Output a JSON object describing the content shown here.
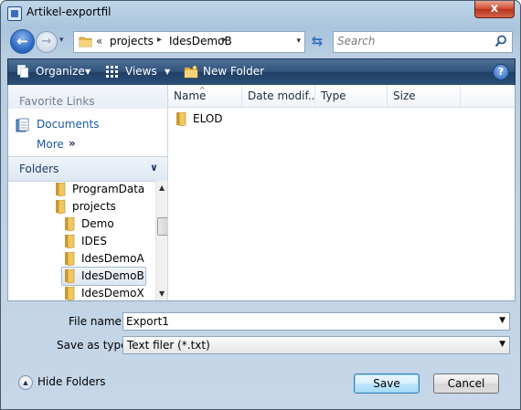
{
  "window": {
    "title": "Artikel-exportfil",
    "close_label": "x"
  },
  "nav": {
    "back_label": "←",
    "forward_label": "→",
    "dropdown": "▾"
  },
  "address": {
    "chevron": "«",
    "segments": [
      "projects",
      "IdesDemoB"
    ],
    "separator": "▸",
    "dropdown": "▾"
  },
  "search": {
    "placeholder": "Search"
  },
  "toolbar": {
    "organize_label": "Organize",
    "views_label": "Views",
    "new_folder_label": "New Folder",
    "dropdown": "▼",
    "help_label": "?"
  },
  "favorites": {
    "title": "Favorite Links",
    "items": [
      {
        "label": "Documents"
      }
    ],
    "more_label": "More",
    "more_arrow": "»"
  },
  "folders": {
    "title": "Folders",
    "chevron": "∨",
    "tree": [
      {
        "label": "ProgramData",
        "level": 0,
        "selected": false
      },
      {
        "label": "projects",
        "level": 0,
        "selected": false
      },
      {
        "label": "Demo",
        "level": 1,
        "selected": false
      },
      {
        "label": "IDES",
        "level": 1,
        "selected": false
      },
      {
        "label": "IdesDemoA",
        "level": 1,
        "selected": false
      },
      {
        "label": "IdesDemoB",
        "level": 1,
        "selected": true
      },
      {
        "label": "IdesDemoX",
        "level": 1,
        "selected": false
      }
    ]
  },
  "file_list": {
    "columns": [
      "Name",
      "Date modif...",
      "Type",
      "Size"
    ],
    "sort_indicator": "^",
    "items": [
      {
        "name": "ELOD"
      }
    ]
  },
  "form": {
    "file_name_label": "File name:",
    "file_name_value": "Export1",
    "save_type_label": "Save as type:",
    "save_type_value": "Text filer (*.txt)",
    "arrow": "▼"
  },
  "footer": {
    "hide_folders_label": "Hide Folders",
    "save_label": "Save",
    "cancel_label": "Cancel"
  },
  "colors": {
    "toolbar": "#2f527b",
    "link": "#1b56a3",
    "folder": "#e8b84a"
  }
}
